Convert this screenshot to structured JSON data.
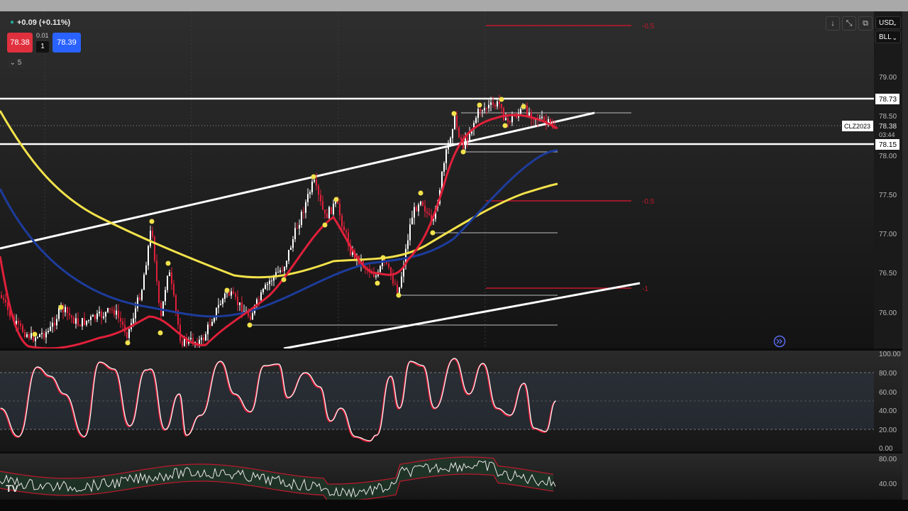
{
  "legend": {
    "change": "+0.09 (+0.11%)",
    "sell_price": "78.38",
    "buy_price": "78.39",
    "spread": "0.01",
    "quantity": "1",
    "collapsed_count": "5",
    "status_icon": "circle-icon"
  },
  "toolbar": {
    "down_icon": "↓",
    "collapse_icon": "⤡",
    "maximize_icon": "⧉",
    "currency": "USD",
    "unit": "BLL"
  },
  "price_axis": {
    "ticks": [
      "79.00",
      "78.50",
      "78.00",
      "77.50",
      "77.00",
      "76.50",
      "76.00"
    ],
    "labels": {
      "resistance": "78.73",
      "last_price": "78.38",
      "countdown": "03:44",
      "support": "78.15",
      "symbol": "CLZ2023"
    }
  },
  "fib_labels": {
    "top": "-0.5",
    "mid": "-0.5",
    "low": "-1"
  },
  "oscillator_axis": [
    "100.00",
    "80.00",
    "60.00",
    "40.00",
    "20.00",
    "0.00"
  ],
  "rsi_axis": [
    "80.00",
    "40.00"
  ],
  "colors": {
    "ema_red": "#e0203a",
    "ema_yellow": "#f2e24b",
    "ema_blue": "#1d3c9c",
    "candle_up": "#ffffff",
    "candle_down": "#e0203a",
    "fib_red": "#c0182c"
  },
  "brand_logo": "TV",
  "scroll_icon": "scroll-to-latest-icon"
}
